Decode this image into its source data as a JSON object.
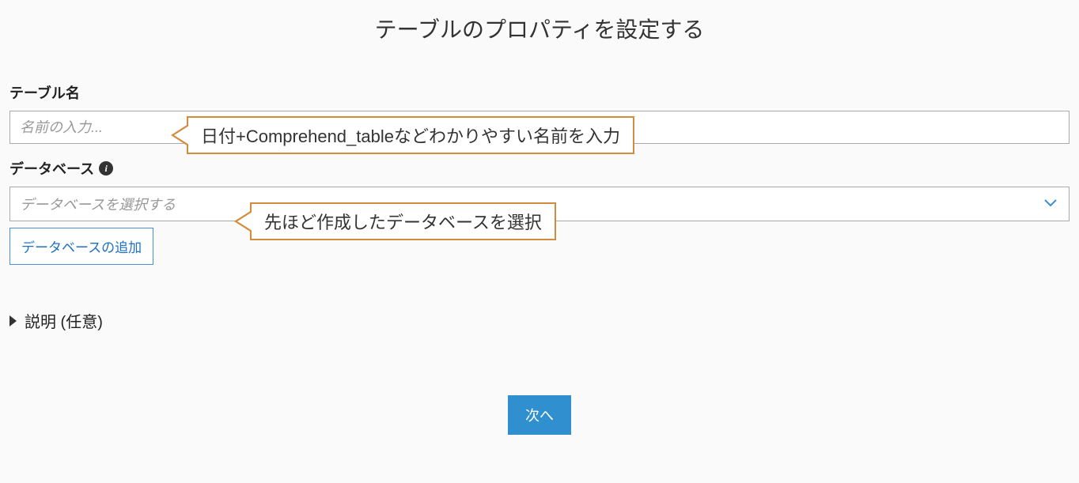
{
  "page": {
    "title": "テーブルのプロパティを設定する"
  },
  "table_name": {
    "label": "テーブル名",
    "placeholder": "名前の入力...",
    "value": ""
  },
  "database": {
    "label": "データベース",
    "placeholder": "データベースを選択する",
    "add_button": "データベースの追加"
  },
  "description": {
    "label": "説明 (任意)"
  },
  "actions": {
    "next": "次へ"
  },
  "callouts": {
    "table_name_hint": "日付+Comprehend_tableなどわかりやすい名前を入力",
    "database_hint": "先ほど作成したデータベースを選択"
  }
}
